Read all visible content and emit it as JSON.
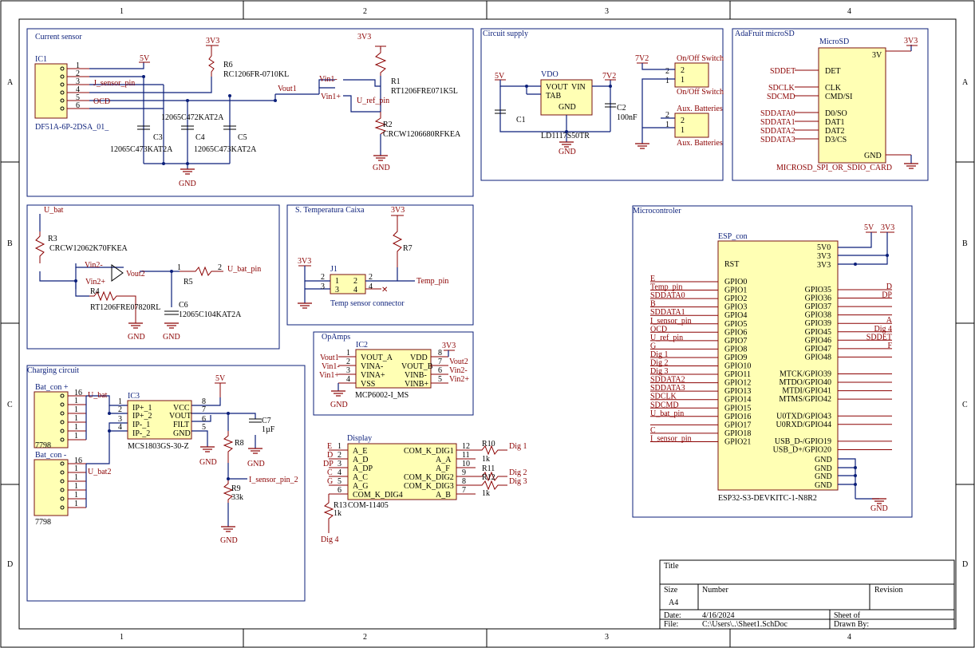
{
  "frame": {
    "columns": [
      "1",
      "2",
      "3",
      "4"
    ],
    "rows": [
      "A",
      "B",
      "C",
      "D"
    ]
  },
  "title_block": {
    "title_label": "Title",
    "size_label": "Size",
    "size_value": "A4",
    "number_label": "Number",
    "revision_label": "Revision",
    "date_label": "Date:",
    "date_value": "4/16/2024",
    "file_label": "File:",
    "file_value": "C:\\Users\\..\\Sheet1.SchDoc",
    "sheet_label": "Sheet  of",
    "drawn_label": "Drawn By:"
  },
  "sections": {
    "current_sensor": "Current sensor",
    "circuit_supply": "Circuit supply",
    "adafruit": "AdaFruit microSD",
    "u_bat": "",
    "temperatura": "S. Temperatura Caixa",
    "opamps": "OpAmps",
    "charging": "Charging circuit",
    "display": "Display",
    "micro": "Microcontroler"
  },
  "current_sensor": {
    "ic1": "IC1",
    "ic1_part": "DF51A-6P-2DSA_01_",
    "pins": [
      "1",
      "2",
      "3",
      "4",
      "5",
      "6"
    ],
    "net_5v": "5V",
    "net_3v3": "3V3",
    "r6": "R6",
    "r6_part": "RC1206FR-0710KL",
    "j_sensor": "J_sensor_pin",
    "ocd": "OCD",
    "c3": "C3",
    "c3_part": "12065C473KAT2A",
    "c4": "C4",
    "c4_part": "12065C472KAT2A",
    "c5": "C5",
    "c5_part": "12065C473KAT2A",
    "vout1": "Vout1",
    "vin1m": "Vin1-",
    "vin1p": "Vin1+",
    "u_ref": "U_ref_pin",
    "r1": "R1",
    "r1_part": "RT1206FRE071K5L",
    "r2": "R2",
    "r2_part": "CRCW1206680RFKEA",
    "gnd": "GND"
  },
  "supply": {
    "net_5v": "5V",
    "vdo": "VDO",
    "vout": "VOUT",
    "vin": "VIN",
    "tab": "TAB",
    "gnd_pin": "GND",
    "net_7v2": "7V2",
    "c1": "C1",
    "c2": "C2",
    "c2_val": "100nF",
    "part": "LD1117S50TR",
    "gnd": "GND",
    "net_7v2b": "7V2",
    "on_off_1": "On/Off Switch",
    "on_off_2": "On/Off Switch",
    "aux_1": "Aux. Batteries",
    "aux_2": "Aux. Batteries"
  },
  "microsd": {
    "title": "MicroSD",
    "net_3v3": "3V3",
    "v3": "3V",
    "pins": [
      "DET",
      "CLK",
      "CMD/SI",
      "D0/SO",
      "DAT1",
      "DAT2",
      "D3/CS",
      "GND"
    ],
    "nets": [
      "SDDET",
      "SDCLK",
      "SDCMD",
      "SDDATA0",
      "SDDATA1",
      "SDDATA2",
      "SDDATA3"
    ],
    "part": "MICROSD_SPI_OR_SDIO_CARD"
  },
  "ubat": {
    "u_bat": "U_bat",
    "r3": "R3",
    "r3_part": "CRCW12062K70FKEA",
    "vin2m": "Vin2-",
    "vin2p": "Vin2+",
    "vout2": "Vout2",
    "r4": "R4",
    "r4_part": "RT1206FRE07820RL",
    "r5": "R5",
    "u_bat_pin": "U_bat_pin",
    "c6": "C6",
    "c6_part": "12065C104KAT2A",
    "gnd": "GND"
  },
  "temp": {
    "net_3v3a": "3V3",
    "net_3v3b": "3V3",
    "j1": "J1",
    "r7": "R7",
    "temp_pin": "Temp_pin",
    "connector": "Temp sensor connector"
  },
  "opamps": {
    "ic2": "IC2",
    "net_3v3": "3V3",
    "left_pins": [
      "VOUT_A",
      "VINA-",
      "VINA+",
      "VSS"
    ],
    "right_pins": [
      "VDD",
      "VOUT_B",
      "VINB-",
      "VINB+"
    ],
    "left_nets": [
      "Vout1",
      "Vin1-",
      "Vin1+"
    ],
    "right_nets": [
      "Vout2",
      "Vin2-",
      "Vin2+"
    ],
    "part": "MCP6002-I_MS",
    "gnd": "GND"
  },
  "charging": {
    "bat_con_p": "Bat_con +",
    "bat_con_m": "Bat_con -",
    "u_bat": "U_bat",
    "u_bat2": "U_bat2",
    "ic3": "IC3",
    "left_pins": [
      "IP+_1",
      "IP+_2",
      "IP-_1",
      "IP-_2"
    ],
    "right_pins": [
      "VCC",
      "VOUT",
      "FILT",
      "GND"
    ],
    "part": "MCS1803GS-30-Z",
    "net_5v": "5V",
    "r8": "R8",
    "r9": "R9",
    "r9_val": "33k",
    "c7": "C7",
    "c7_val": "1µF",
    "i_sensor": "I_sensor_pin_2",
    "con_part_a": "7798",
    "con_part_b": "7798",
    "gnd": "GND"
  },
  "display": {
    "left_pins": [
      "A_E",
      "A_D",
      "A_DP",
      "A_C",
      "A_G",
      "COM_K_DIG4"
    ],
    "right_pins": [
      "COM_K_DIG1",
      "A_A",
      "A_F",
      "COM_K_DIG2",
      "COM_K_DIG3",
      "A_B"
    ],
    "left_nets": [
      "E",
      "D",
      "DP",
      "C",
      "G"
    ],
    "r10": "R10",
    "r11": "R11",
    "r12": "R12",
    "r13": "R13",
    "r_val": "1k",
    "dig1": "Dig 1",
    "dig2": "Dig 2",
    "dig3": "Dig 3",
    "dig4": "Dig 4",
    "part": "COM-11405"
  },
  "esp": {
    "title": "ESP_con",
    "net_5v": "5V",
    "net_3v3": "3V3",
    "top_right": [
      "5V0",
      "3V3",
      "3V3"
    ],
    "rst": "RST",
    "left_pins": [
      "GPIO0",
      "GPIO1",
      "GPIO2",
      "GPIO3",
      "GPIO4",
      "GPIO5",
      "GPIO6",
      "GPIO7",
      "GPIO8",
      "GPIO9",
      "GPIO10",
      "GPIO11",
      "GPIO12",
      "GPIO13",
      "GPIO14",
      "GPIO15",
      "GPIO16",
      "GPIO17",
      "GPIO18",
      "GPIO21"
    ],
    "left_nets": [
      "E",
      "Temp_pin",
      "SDDATA0",
      "B",
      "SDDATA1",
      "I_sensor_pin",
      "OCD",
      "U_ref_pin",
      "G",
      "Dig 1",
      "Dig 2",
      "Dig 3",
      "SDDATA2",
      "SDDATA3",
      "SDCLK",
      "SDCMD",
      "U_bat_pin",
      "",
      "C",
      "I_sensor_pin"
    ],
    "right_pins": [
      "GPIO35",
      "GPIO36",
      "GPIO37",
      "GPIO38",
      "GPIO39",
      "GPIO45",
      "GPIO46",
      "GPIO47",
      "GPIO48",
      "",
      "MTCK/GPIO39",
      "MTDO/GPIO40",
      "MTDI/GPIO41",
      "MTMS/GPIO42",
      "",
      "U0TXD/GPIO43",
      "U0RXD/GPIO44",
      "",
      "USB_D-/GPIO19",
      "USB_D+/GPIO20"
    ],
    "right_nets": [
      "D",
      "DP",
      "",
      "",
      "A",
      "Dig 4",
      "SDDET",
      "F"
    ],
    "gnd_pins": [
      "GND",
      "GND",
      "GND",
      "GND"
    ],
    "part": "ESP32-S3-DEVKITC-1-N8R2",
    "gnd": "GND"
  }
}
